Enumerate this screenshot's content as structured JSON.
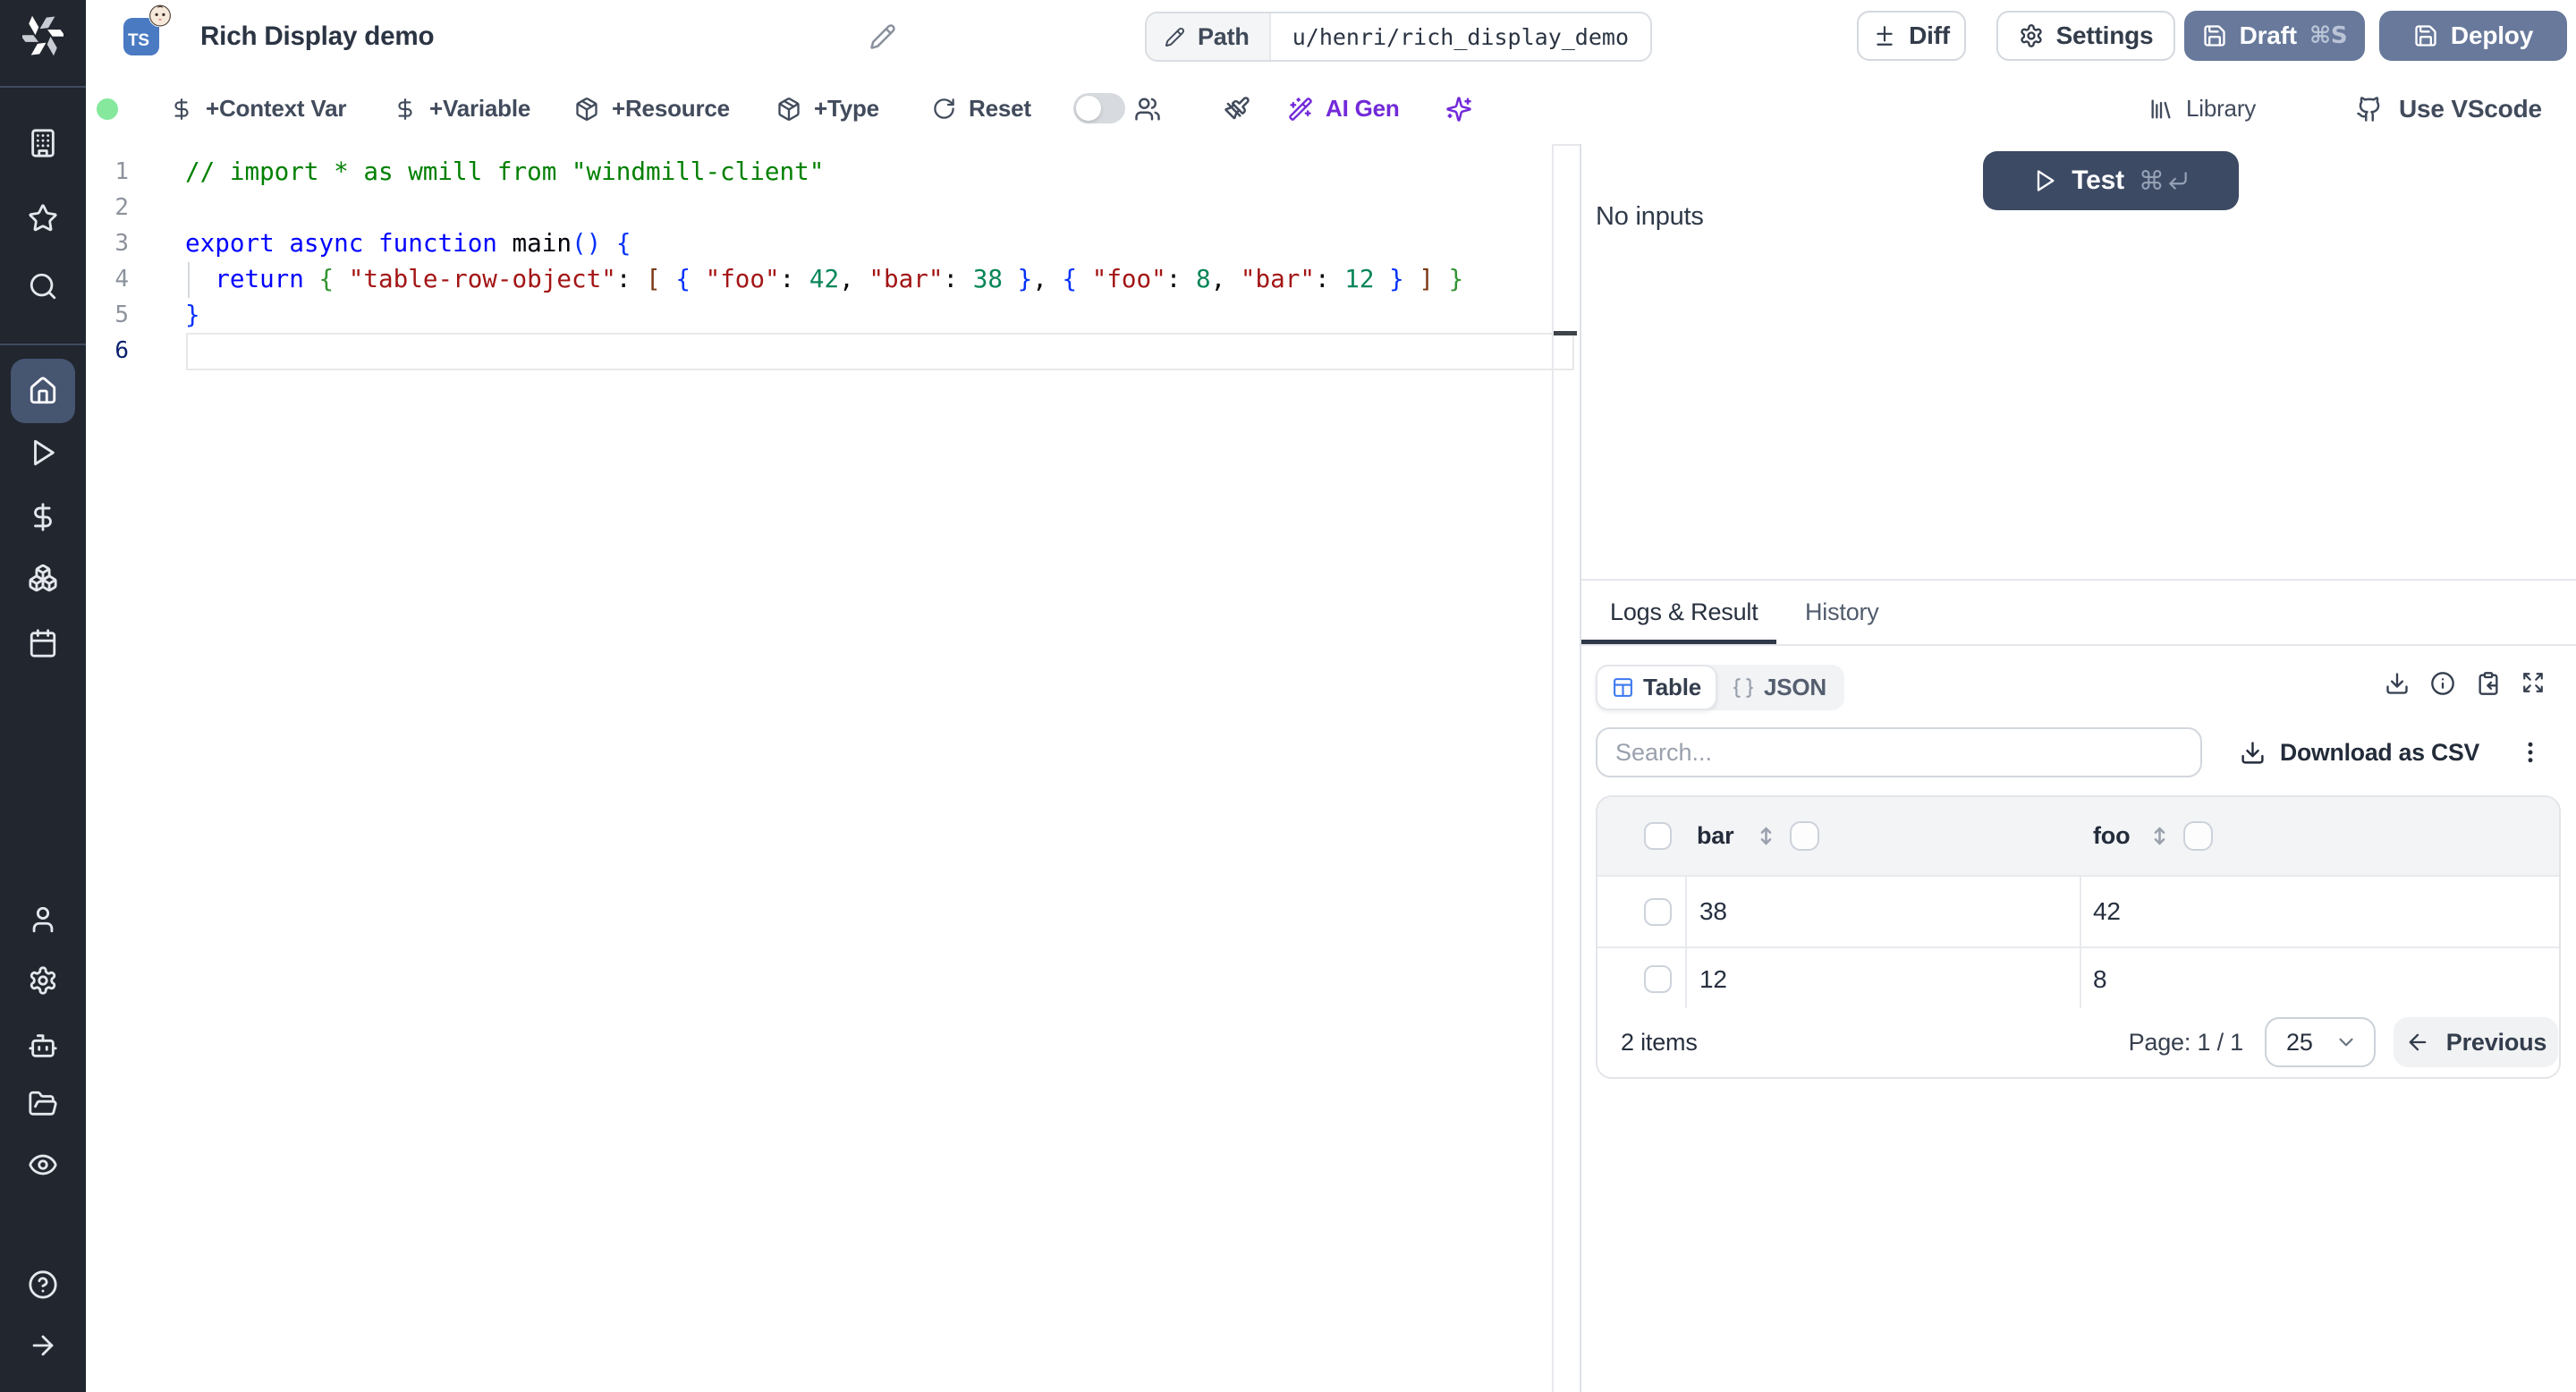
{
  "colors": {
    "sidebar_bg": "#21262f",
    "sidebar_active_bg": "#465570",
    "ts_badge_blue": "#4a7ac2",
    "slate_button": "#68799b",
    "test_button": "#3c4a64",
    "accent_purple": "#7229d9",
    "table_icon_blue": "#3c78f0",
    "status_green": "#85e89d",
    "tab_underline": "#2f3949"
  },
  "sidebar": {
    "top_items": [
      {
        "name": "workspace",
        "icon": "building"
      },
      {
        "name": "favorites",
        "icon": "star"
      },
      {
        "name": "search",
        "icon": "search"
      }
    ],
    "active_item": {
      "name": "home",
      "icon": "home"
    },
    "main_items": [
      {
        "name": "runs",
        "icon": "play"
      },
      {
        "name": "variables",
        "icon": "dollar"
      },
      {
        "name": "resources",
        "icon": "boxes"
      },
      {
        "name": "schedules",
        "icon": "calendar"
      }
    ],
    "bottom_items": [
      {
        "name": "user",
        "icon": "user"
      },
      {
        "name": "settings",
        "icon": "gear"
      },
      {
        "name": "workers",
        "icon": "bot"
      },
      {
        "name": "folders",
        "icon": "folder-open"
      },
      {
        "name": "audit-logs",
        "icon": "eye"
      },
      {
        "name": "help",
        "icon": "help-circle"
      },
      {
        "name": "expand-sidebar",
        "icon": "arrow-right"
      }
    ]
  },
  "header": {
    "language_badge": "TS",
    "title": "Rich Display demo",
    "path_label": "Path",
    "path_value": "u/henri/rich_display_demo",
    "diff_label": "Diff",
    "settings_label": "Settings",
    "draft_label": "Draft",
    "draft_shortcut": "⌘S",
    "deploy_label": "Deploy"
  },
  "toolbar": {
    "context_var_label": "+Context Var",
    "variable_label": "+Variable",
    "resource_label": "+Resource",
    "type_label": "+Type",
    "reset_label": "Reset",
    "ai_gen_label": "AI Gen",
    "library_label": "Library",
    "vscode_label": "Use VScode"
  },
  "editor": {
    "lines": [
      {
        "n": "1",
        "tokens": [
          [
            "// import * as wmill from \"windmill-client\"",
            "comment"
          ]
        ]
      },
      {
        "n": "2",
        "tokens": []
      },
      {
        "n": "3",
        "tokens": [
          [
            "export",
            "kw"
          ],
          [
            " ",
            "pl"
          ],
          [
            "async",
            "kw"
          ],
          [
            " ",
            "pl"
          ],
          [
            "function",
            "kw"
          ],
          [
            " ",
            "pl"
          ],
          [
            "main",
            "fn"
          ],
          [
            "(",
            "b1"
          ],
          [
            ")",
            "b1"
          ],
          [
            " ",
            "pl"
          ],
          [
            "{",
            "b1"
          ]
        ]
      },
      {
        "n": "4",
        "tokens": [
          [
            "  ",
            "pl"
          ],
          [
            "return",
            "kw"
          ],
          [
            " ",
            "pl"
          ],
          [
            "{",
            "b2"
          ],
          [
            " ",
            "pl"
          ],
          [
            "\"table-row-object\"",
            "str"
          ],
          [
            ":",
            "pl"
          ],
          [
            " ",
            "pl"
          ],
          [
            "[",
            "b3"
          ],
          [
            " ",
            "pl"
          ],
          [
            "{",
            "b1"
          ],
          [
            " ",
            "pl"
          ],
          [
            "\"foo\"",
            "str"
          ],
          [
            ":",
            "pl"
          ],
          [
            " ",
            "pl"
          ],
          [
            "42",
            "num"
          ],
          [
            ",",
            "pl"
          ],
          [
            " ",
            "pl"
          ],
          [
            "\"bar\"",
            "str"
          ],
          [
            ":",
            "pl"
          ],
          [
            " ",
            "pl"
          ],
          [
            "38",
            "num"
          ],
          [
            " ",
            "pl"
          ],
          [
            "}",
            "b1"
          ],
          [
            ",",
            "pl"
          ],
          [
            " ",
            "pl"
          ],
          [
            "{",
            "b1"
          ],
          [
            " ",
            "pl"
          ],
          [
            "\"foo\"",
            "str"
          ],
          [
            ":",
            "pl"
          ],
          [
            " ",
            "pl"
          ],
          [
            "8",
            "num"
          ],
          [
            ",",
            "pl"
          ],
          [
            " ",
            "pl"
          ],
          [
            "\"bar\"",
            "str"
          ],
          [
            ":",
            "pl"
          ],
          [
            " ",
            "pl"
          ],
          [
            "12",
            "num"
          ],
          [
            " ",
            "pl"
          ],
          [
            "}",
            "b1"
          ],
          [
            " ",
            "pl"
          ],
          [
            "]",
            "b3"
          ],
          [
            " ",
            "pl"
          ],
          [
            "}",
            "b2"
          ]
        ]
      },
      {
        "n": "5",
        "tokens": [
          [
            "}",
            "b1"
          ]
        ]
      },
      {
        "n": "6",
        "tokens": [],
        "current": true
      }
    ]
  },
  "run_panel": {
    "test_label": "Test",
    "test_shortcut_cmd": "⌘",
    "no_inputs_text": "No inputs"
  },
  "result_panel": {
    "tabs": [
      {
        "label": "Logs & Result",
        "active": true
      },
      {
        "label": "History",
        "active": false
      }
    ],
    "view_toggle": {
      "table_label": "Table",
      "json_label": "JSON"
    },
    "search_placeholder": "Search...",
    "download_csv_label": "Download as CSV",
    "table": {
      "columns": [
        "bar",
        "foo"
      ],
      "rows": [
        [
          "38",
          "42"
        ],
        [
          "12",
          "8"
        ]
      ]
    },
    "footer": {
      "items_count": "2 items",
      "page_label": "Page: 1 / 1",
      "page_size": "25",
      "previous_label": "Previous"
    }
  }
}
